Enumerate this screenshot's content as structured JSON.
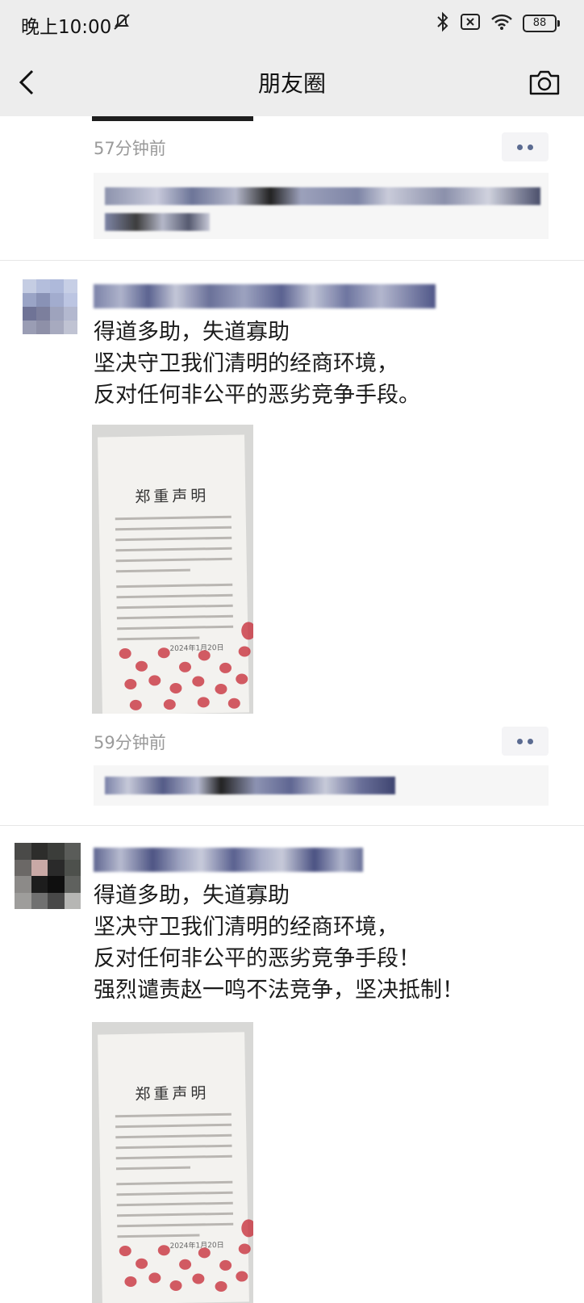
{
  "status_bar": {
    "time": "晚上10:00",
    "battery": "88",
    "icons": [
      "mute-icon",
      "bluetooth-icon",
      "sim-off-icon",
      "wifi-icon",
      "battery-icon"
    ]
  },
  "nav": {
    "title": "朋友圈",
    "back_icon": "chevron-left-icon",
    "camera_icon": "camera-icon"
  },
  "feed": {
    "prev_post": {
      "time": "57分钟前"
    },
    "posts": [
      {
        "text": "得道多助，失道寡助\n坚决守卫我们清明的经商环境，\n反对任何非公平的恶劣竞争手段。",
        "image_title": "郑重声明",
        "image_date": "2024年1月20日",
        "time": "59分钟前"
      },
      {
        "text": "得道多助，失道寡助\n坚决守卫我们清明的经商环境，\n反对任何非公平的恶劣竞争手段！\n强烈谴责赵一鸣不法竞争，坚决抵制！",
        "image_title": "郑重声明",
        "image_date": "2024年1月20日"
      }
    ]
  },
  "colors": {
    "bar_bg": "#ededed",
    "link_blue": "#5b6b91",
    "time_gray": "#9a9a9a",
    "fingerprint_red": "#c8333f"
  }
}
